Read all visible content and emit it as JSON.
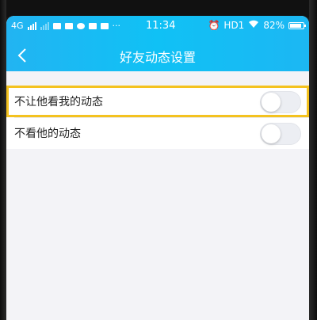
{
  "status_bar": {
    "network": "4G",
    "time": "11:34",
    "hd_label": "HD1",
    "battery_percent": "82%",
    "dots": "···"
  },
  "header": {
    "title": "好友动态设置",
    "back_icon": "chevron-left-icon"
  },
  "settings": [
    {
      "label": "不让他看我的动态",
      "enabled": false
    },
    {
      "label": "不看他的动态",
      "enabled": false
    }
  ],
  "colors": {
    "header_blue": "#22b4f2",
    "highlight_yellow": "#f4c21f",
    "background": "#f3f3f7"
  }
}
